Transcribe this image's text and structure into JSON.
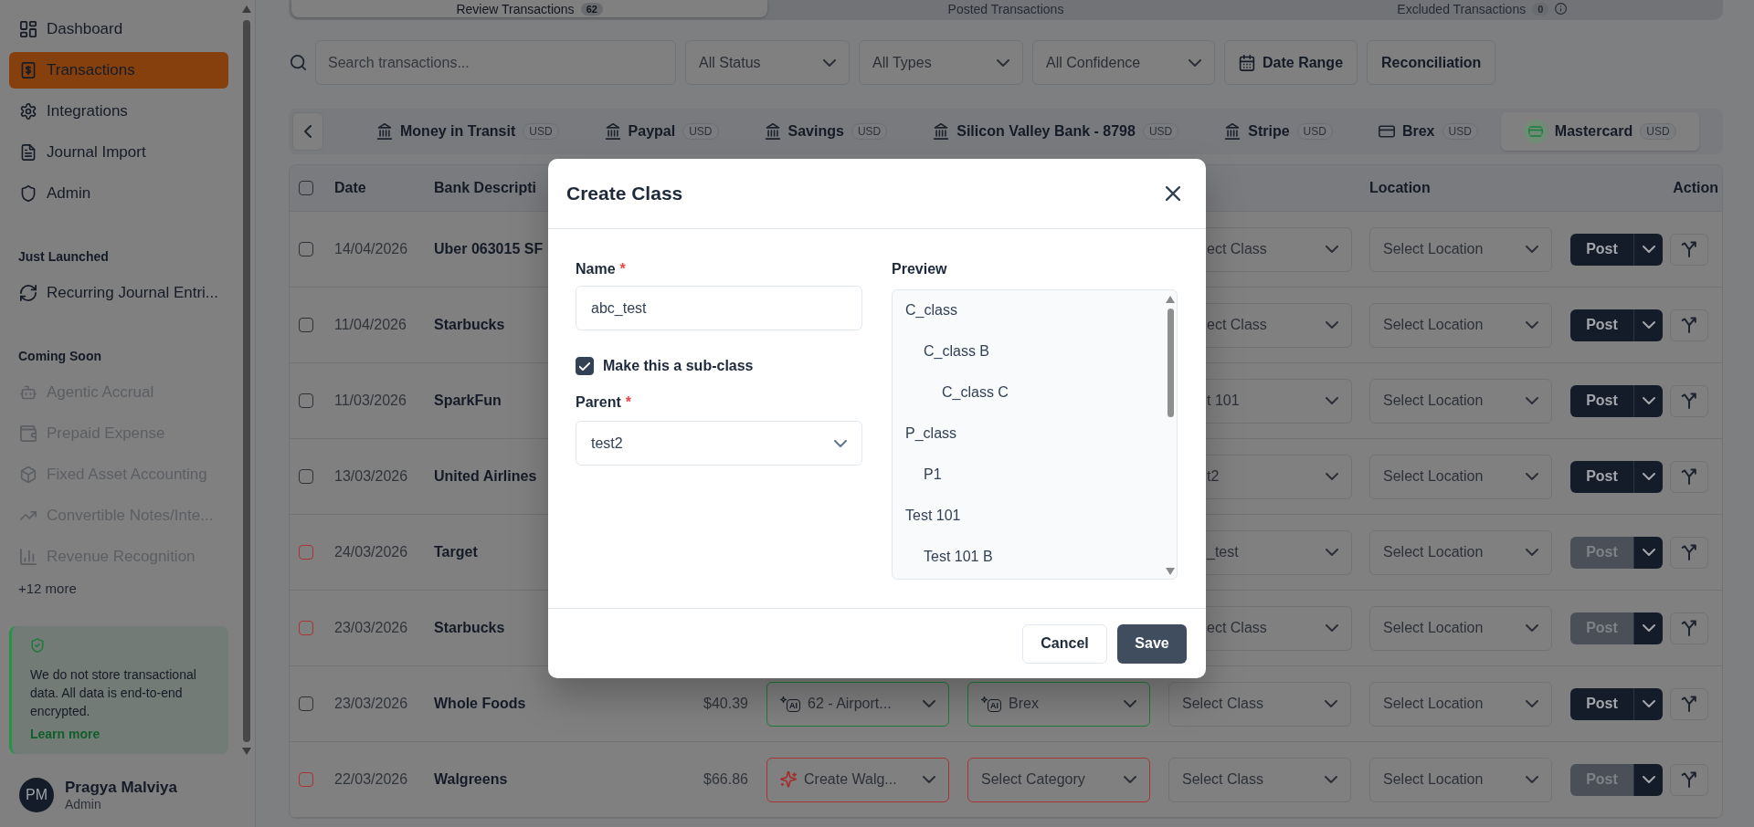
{
  "sidebar": {
    "sections": [
      {
        "items": [
          {
            "label": "Dashboard",
            "selected": false,
            "disabled": false
          },
          {
            "label": "Transactions",
            "selected": true,
            "disabled": false
          },
          {
            "label": "Integrations",
            "selected": false,
            "disabled": false
          },
          {
            "label": "Journal Import",
            "selected": false,
            "disabled": false
          },
          {
            "label": "Admin",
            "selected": false,
            "disabled": false
          }
        ]
      },
      {
        "title": "Just Launched",
        "items": [
          {
            "label": "Recurring Journal Entri...",
            "selected": false,
            "disabled": false
          }
        ]
      },
      {
        "title": "Coming Soon",
        "items": [
          {
            "label": "Agentic Accrual",
            "selected": false,
            "disabled": true
          },
          {
            "label": "Prepaid Expense",
            "selected": false,
            "disabled": true
          },
          {
            "label": "Fixed Asset Accounting",
            "selected": false,
            "disabled": true
          },
          {
            "label": "Convertible Notes/Inte...",
            "selected": false,
            "disabled": true
          },
          {
            "label": "Revenue Recognition",
            "selected": false,
            "disabled": true
          }
        ],
        "more": "+12 more"
      }
    ],
    "notice": {
      "text": "We do not store transactional data. All data is end-to-end encrypted.",
      "link": "Learn more"
    },
    "user": {
      "initials": "PM",
      "name": "Pragya Malviya",
      "role": "Admin"
    }
  },
  "status_tabs": [
    {
      "label": "Review Transactions",
      "count": "62",
      "info": false,
      "selected": true
    },
    {
      "label": "Posted Transactions",
      "info": false,
      "selected": false
    },
    {
      "label": "Excluded Transactions",
      "count": "0",
      "info": true,
      "selected": false
    }
  ],
  "filters": {
    "search": {
      "placeholder": "Search transactions..."
    },
    "dropdowns": [
      "All Status",
      "All Types",
      "All Confidence"
    ],
    "buttons": [
      {
        "label": "Date Range",
        "kind": "date"
      },
      {
        "label": "Reconciliation",
        "kind": "plain"
      }
    ]
  },
  "accounts": [
    {
      "label": "Money in Transit",
      "currency": "USD",
      "kind": "bank",
      "selected": false
    },
    {
      "label": "Paypal",
      "currency": "USD",
      "kind": "bank",
      "selected": false
    },
    {
      "label": "Savings",
      "currency": "USD",
      "kind": "bank",
      "selected": false
    },
    {
      "label": "Silicon Valley Bank - 8798",
      "currency": "USD",
      "kind": "bank",
      "selected": false
    },
    {
      "label": "Stripe",
      "currency": "USD",
      "kind": "bank",
      "selected": false
    },
    {
      "label": "Brex",
      "currency": "USD",
      "kind": "card",
      "selected": false
    },
    {
      "label": "Mastercard",
      "currency": "USD",
      "kind": "card",
      "selected": true
    }
  ],
  "table": {
    "header_checked": false,
    "headers": [
      "Date",
      "Bank Descripti",
      "Location",
      "Action"
    ],
    "rows": [
      {
        "checked": false,
        "needs_review": false,
        "date": "14/04/2026",
        "description": "Uber 063015 SF",
        "column_6": "ect Class",
        "location": "Select Location",
        "post": "Post"
      },
      {
        "checked": false,
        "needs_review": false,
        "date": "11/04/2026",
        "description": "Starbucks",
        "column_6": "ect Class",
        "location": "Select Location",
        "post": "Post"
      },
      {
        "checked": false,
        "needs_review": false,
        "date": "11/03/2026",
        "description": "SparkFun",
        "column_6": "t 101",
        "location": "Select Location",
        "post": "Post"
      },
      {
        "checked": false,
        "needs_review": false,
        "date": "13/03/2026",
        "description": "United Airlines",
        "column_6": "t2",
        "location": "Select Location",
        "post": "Post"
      },
      {
        "checked": false,
        "needs_review": true,
        "date": "24/03/2026",
        "description": "Target",
        "column_6": "_test",
        "location": "Select Location",
        "post": "Post"
      },
      {
        "checked": false,
        "needs_review": true,
        "date": "23/03/2026",
        "description": "Starbucks",
        "column_6": "ect Class",
        "location": "Select Location",
        "post": "Post"
      },
      {
        "checked": false,
        "needs_review": false,
        "date": "23/03/2026",
        "description": "Whole Foods",
        "column_3": "$40.39",
        "column_4": {
          "text": "62 - Airport...",
          "kind": "ai",
          "badge": "AI",
          "missing": false
        },
        "column_5": {
          "text": "Brex",
          "kind": "ai",
          "badge": "AI",
          "missing": false
        },
        "column_6": "Select Class",
        "location": "Select Location",
        "post": "Post"
      },
      {
        "checked": false,
        "needs_review": true,
        "date": "22/03/2026",
        "description": "Walgreens",
        "column_3": "$66.86",
        "column_4": {
          "text": "Create Walg...",
          "kind": "create",
          "missing": true
        },
        "column_5": {
          "text": "Select Category",
          "kind": "plain",
          "missing": true
        },
        "column_6": "Select Class",
        "location": "Select Location",
        "post": "Post"
      }
    ]
  },
  "dialog": {
    "title": "Create Class",
    "name_field": {
      "label": "Name",
      "required_mark": "*",
      "value": "abc_test"
    },
    "subclass": {
      "label": "Make this a sub-class",
      "checked": true
    },
    "parent_field": {
      "label": "Parent",
      "required_mark": "*",
      "value": "test2"
    },
    "preview": {
      "label": "Preview",
      "tree": [
        {
          "label": "C_class",
          "children": [
            {
              "label": "C_class B",
              "children": [
                {
                  "label": "C_class C"
                }
              ]
            }
          ]
        },
        {
          "label": "P_class",
          "children": [
            {
              "label": "P1"
            }
          ]
        },
        {
          "label": "Test 101",
          "children": [
            {
              "label": "Test 101 B"
            }
          ]
        }
      ]
    },
    "buttons": [
      {
        "label": "Cancel",
        "kind": "secondary"
      },
      {
        "label": "Save",
        "kind": "primary"
      }
    ]
  }
}
